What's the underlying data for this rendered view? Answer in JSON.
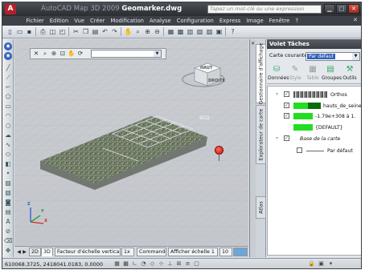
{
  "window": {
    "app_name": "AutoCAD Map 3D 2009",
    "file_name": "Geomarker.dwg",
    "search_placeholder": "Tapez un mot-clé ou une expression",
    "logo_letter": "A"
  },
  "menu": [
    "Fichier",
    "Edition",
    "Vue",
    "Créer",
    "Modification",
    "Analyse",
    "Configuration",
    "Express",
    "Image",
    "Fenêtre",
    "?"
  ],
  "viewport": {
    "scg_label": "SCG",
    "viewcube": {
      "top_label": "HAUT",
      "face_label": "DROITE"
    },
    "ucs_labels": {
      "x": "X",
      "y": "Y",
      "z": "Z"
    }
  },
  "bottom_tabs": {
    "tabs": [
      "2D",
      "3D"
    ],
    "vertical_scale_label": "Facteur d'échelle verticale:",
    "vertical_scale_value": "1x",
    "command_label": "Commande",
    "show_scale_label": "Afficher échelle 1",
    "scale_value": "10"
  },
  "statusbar": {
    "coordinates": "610068.3725, 2418041.0183, 0.0000"
  },
  "task_pane": {
    "title": "Volet Tâches",
    "current_map_label": "Carte courante:",
    "current_map_value": "Par défaut",
    "vertical_tabs": [
      "Gestionnaire d'affichage",
      "Explorateur de carte",
      "Atlas"
    ],
    "tools": [
      {
        "label": "Données",
        "icon": "data-icon",
        "enabled": true
      },
      {
        "label": "Style",
        "icon": "style-icon",
        "enabled": false
      },
      {
        "label": "Table",
        "icon": "table-icon",
        "enabled": false
      },
      {
        "label": "Groupes",
        "icon": "groups-icon",
        "enabled": true
      },
      {
        "label": "Outils",
        "icon": "tools-icon",
        "enabled": true
      }
    ],
    "layers": {
      "orthos": "Orthos",
      "hauts_de_seine": "hauts_de_seine",
      "range": "-1.79e+308 à 1.",
      "default_style": "{DEFAULT}",
      "base_map": "Base de la carte",
      "par_defaut": "Par défaut"
    },
    "colors": {
      "swatch_green": "#22dd22",
      "swatch_dark": "#0a6a0a"
    }
  },
  "colors": {
    "title_bar": "#2e3136",
    "viewport_bg": "#c8cbd0",
    "marker_red": "#d91e12"
  }
}
